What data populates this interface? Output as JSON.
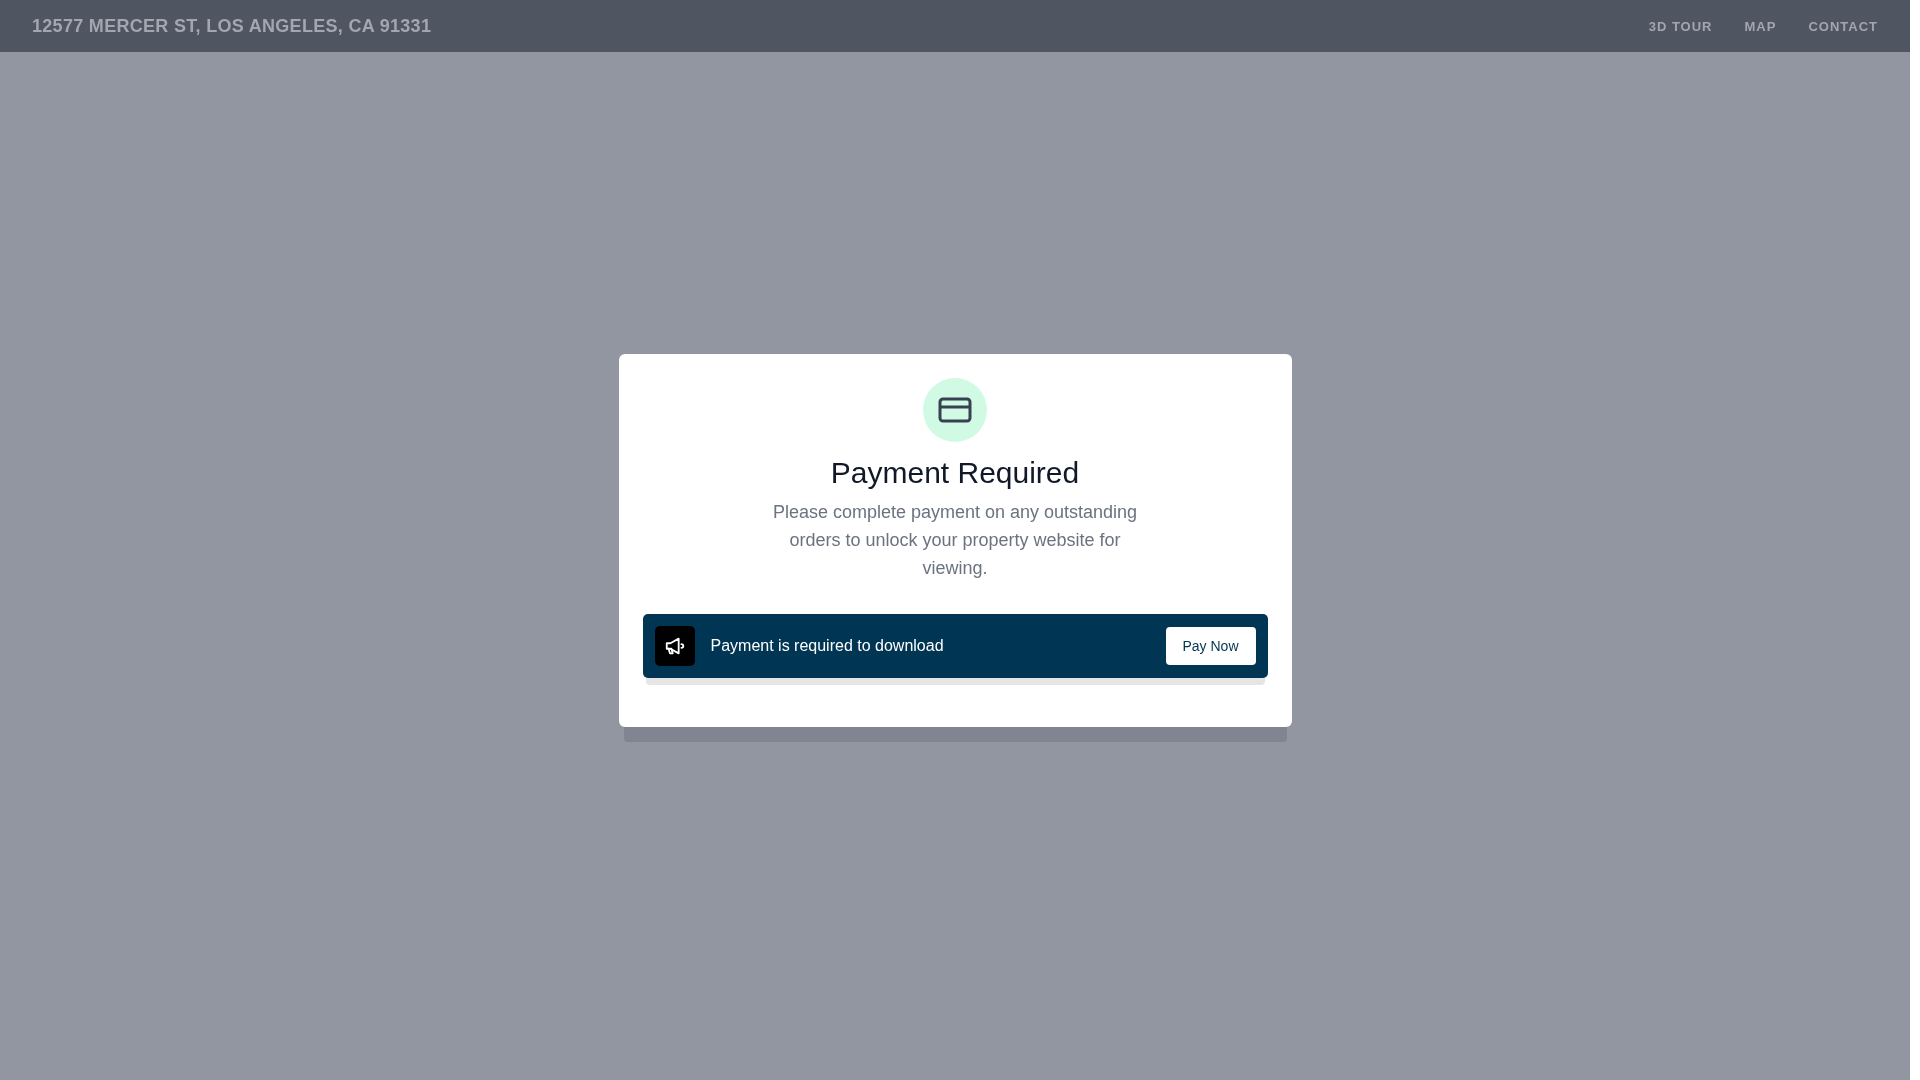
{
  "header": {
    "title": "12577 MERCER ST, LOS ANGELES, CA 91331",
    "nav": [
      "3D TOUR",
      "MAP",
      "CONTACT"
    ]
  },
  "modal": {
    "title": "Payment Required",
    "message": "Please complete payment on any outstanding orders to unlock your property website for viewing.",
    "banner": {
      "text": "Payment is required to download",
      "button": "Pay Now"
    }
  }
}
